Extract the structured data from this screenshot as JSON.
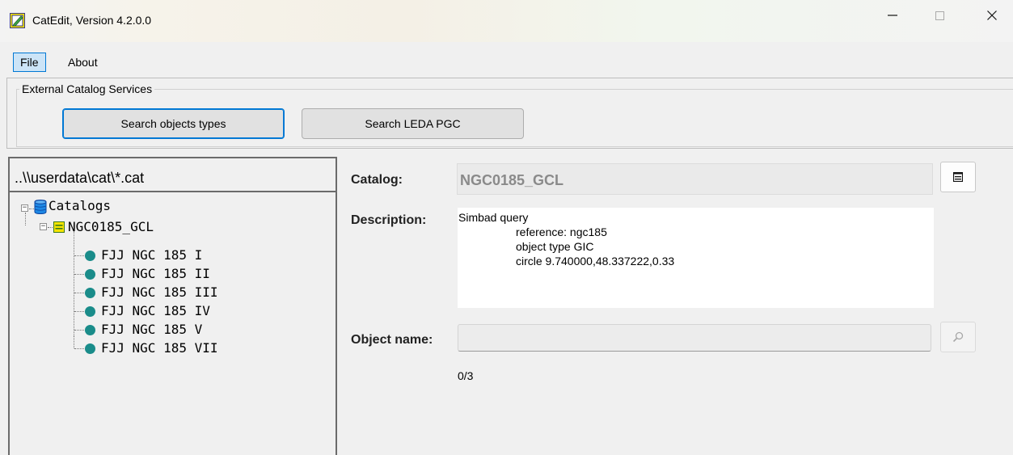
{
  "window": {
    "title": "CatEdit, Version 4.2.0.0",
    "minimize_icon": "minimize-icon",
    "maximize_icon": "maximize-icon",
    "close_icon": "close-icon"
  },
  "menu": {
    "items": [
      {
        "label": "File",
        "active": true
      },
      {
        "label": "About",
        "active": false
      }
    ]
  },
  "external_services": {
    "group_label": "External Catalog Services",
    "buttons": [
      {
        "label": "Search objects types",
        "focused": true
      },
      {
        "label": "Search LEDA PGC",
        "focused": false
      }
    ]
  },
  "tree": {
    "path": "..\\\\userdata\\cat\\*.cat",
    "root": {
      "label": "Catalogs",
      "icon": "database-icon",
      "expanded": true
    },
    "catalog": {
      "label": "NGC0185_GCL",
      "icon": "catalog-icon",
      "expanded": true
    },
    "objects": [
      "FJJ NGC 185 I",
      "FJJ NGC 185 II",
      "FJJ NGC 185 III",
      "FJJ NGC 185 IV",
      "FJJ NGC 185 V",
      "FJJ NGC 185 VII"
    ]
  },
  "details": {
    "catalog_label": "Catalog:",
    "catalog_value": "NGC0185_GCL",
    "description_label": "Description:",
    "description_lines": [
      "Simbad query",
      "reference: ngc185",
      "object type GIC",
      "circle 9.740000,48.337222,0.33"
    ],
    "object_name_label": "Object name:",
    "object_name_value": "",
    "count": "0/3"
  },
  "colors": {
    "accent": "#0078d4",
    "leaf_dot": "#1a8c8a",
    "menu_active_bg": "#cce4f7"
  }
}
